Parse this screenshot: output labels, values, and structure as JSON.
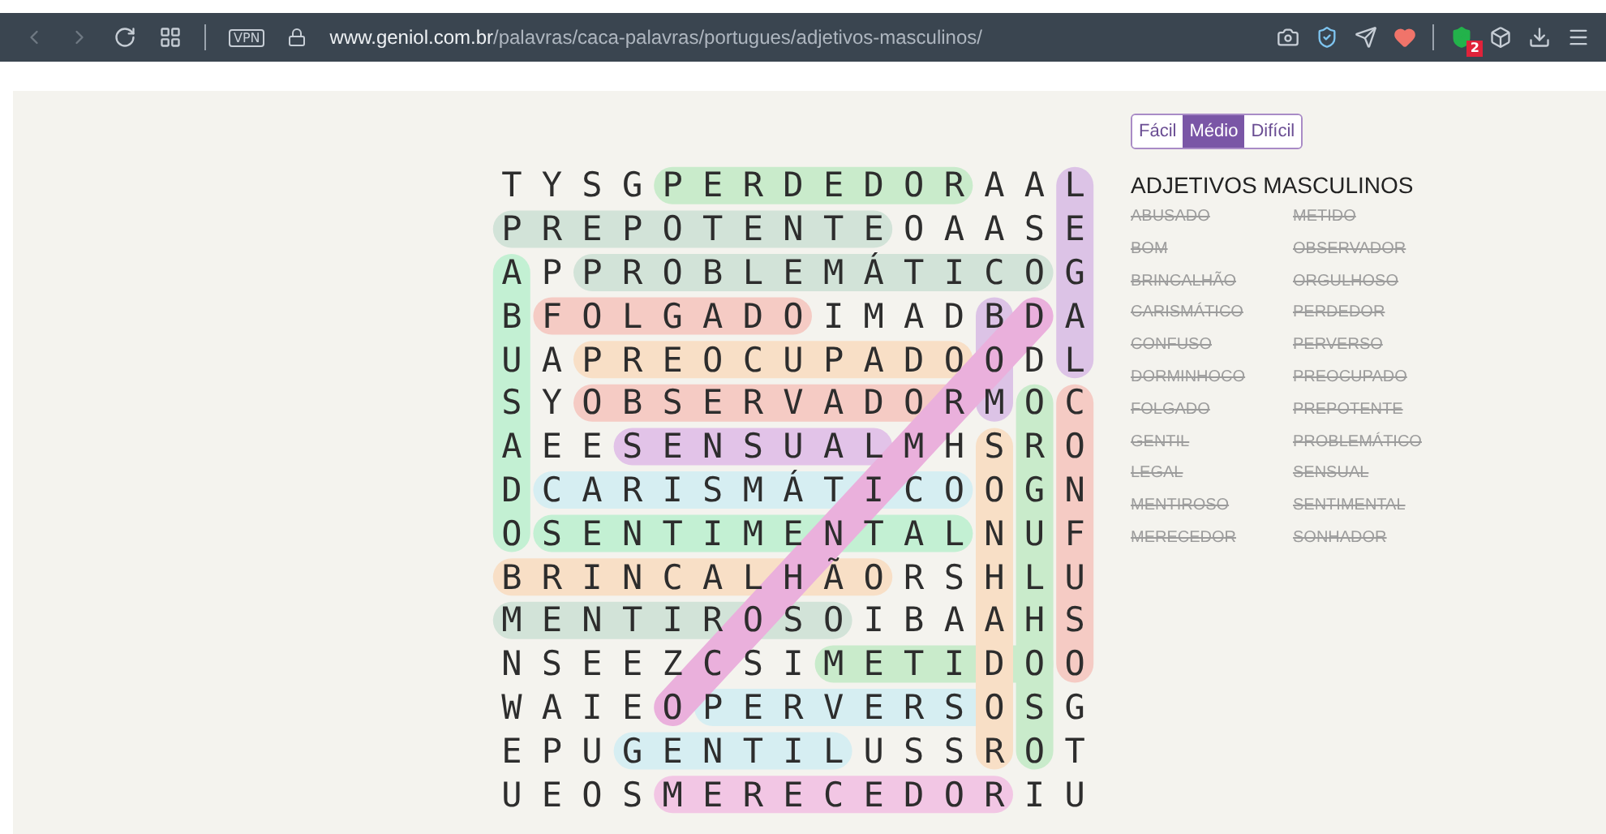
{
  "browser": {
    "vpn_badge": "VPN",
    "url_host": "www.geniol.com.br",
    "url_path": "/palavras/caca-palavras/portugues/adjetivos-masculinos/",
    "extension_badge": "2"
  },
  "difficulty": [
    {
      "label": "Fácil",
      "selected": false
    },
    {
      "label": "Médio",
      "selected": true
    },
    {
      "label": "Difícil",
      "selected": false
    }
  ],
  "grid": {
    "rows": [
      [
        "T",
        "Y",
        "S",
        "G",
        "P",
        "E",
        "R",
        "D",
        "E",
        "D",
        "O",
        "R",
        "A",
        "A",
        "L"
      ],
      [
        "P",
        "R",
        "E",
        "P",
        "O",
        "T",
        "E",
        "N",
        "T",
        "E",
        "O",
        "A",
        "A",
        "S",
        "E"
      ],
      [
        "A",
        "P",
        "P",
        "R",
        "O",
        "B",
        "L",
        "E",
        "M",
        "Á",
        "T",
        "I",
        "C",
        "O",
        "G"
      ],
      [
        "B",
        "F",
        "O",
        "L",
        "G",
        "A",
        "D",
        "O",
        "I",
        "M",
        "A",
        "D",
        "B",
        "D",
        "A"
      ],
      [
        "U",
        "A",
        "P",
        "R",
        "E",
        "O",
        "C",
        "U",
        "P",
        "A",
        "D",
        "O",
        "O",
        "D",
        "L"
      ],
      [
        "S",
        "Y",
        "O",
        "B",
        "S",
        "E",
        "R",
        "V",
        "A",
        "D",
        "O",
        "R",
        "M",
        "O",
        "C"
      ],
      [
        "A",
        "E",
        "E",
        "S",
        "E",
        "N",
        "S",
        "U",
        "A",
        "L",
        "M",
        "H",
        "S",
        "R",
        "O"
      ],
      [
        "D",
        "C",
        "A",
        "R",
        "I",
        "S",
        "M",
        "Á",
        "T",
        "I",
        "C",
        "O",
        "O",
        "G",
        "N"
      ],
      [
        "O",
        "S",
        "E",
        "N",
        "T",
        "I",
        "M",
        "E",
        "N",
        "T",
        "A",
        "L",
        "N",
        "U",
        "F"
      ],
      [
        "B",
        "R",
        "I",
        "N",
        "C",
        "A",
        "L",
        "H",
        "Ã",
        "O",
        "R",
        "S",
        "H",
        "L",
        "U"
      ],
      [
        "M",
        "E",
        "N",
        "T",
        "I",
        "R",
        "O",
        "S",
        "O",
        "I",
        "B",
        "A",
        "A",
        "H",
        "S"
      ],
      [
        "N",
        "S",
        "E",
        "E",
        "Z",
        "C",
        "S",
        "I",
        "M",
        "E",
        "T",
        "I",
        "D",
        "O",
        "O"
      ],
      [
        "W",
        "A",
        "I",
        "E",
        "O",
        "P",
        "E",
        "R",
        "V",
        "E",
        "R",
        "S",
        "O",
        "S",
        "G"
      ],
      [
        "E",
        "P",
        "U",
        "G",
        "E",
        "N",
        "T",
        "I",
        "L",
        "U",
        "S",
        "S",
        "R",
        "O",
        "T"
      ],
      [
        "U",
        "E",
        "O",
        "S",
        "M",
        "E",
        "R",
        "E",
        "C",
        "E",
        "D",
        "O",
        "R",
        "I",
        "U"
      ]
    ]
  },
  "word_list": {
    "title": "ADJETIVOS MASCULINOS",
    "words": [
      {
        "text": "ABUSADO",
        "found": true,
        "color": "#c3f0d3"
      },
      {
        "text": "BOM",
        "found": true,
        "color": "#dcc3e6"
      },
      {
        "text": "BRINCALHÃO",
        "found": true,
        "color": "#f8dfc6"
      },
      {
        "text": "CARISMÁTICO",
        "found": true,
        "color": "#d6eef2"
      },
      {
        "text": "CONFUSO",
        "found": true,
        "color": "#f5cbc4"
      },
      {
        "text": "DORMINHOCO",
        "found": true,
        "color": "#eab0dc"
      },
      {
        "text": "FOLGADO",
        "found": true,
        "color": "#f5cbc4"
      },
      {
        "text": "GENTIL",
        "found": true,
        "color": "#d6eef2"
      },
      {
        "text": "LEGAL",
        "found": true,
        "color": "#dcc3e6"
      },
      {
        "text": "MENTIROSO",
        "found": true,
        "color": "#d2e3d8"
      },
      {
        "text": "MERECEDOR",
        "found": true,
        "color": "#f2c6e4"
      },
      {
        "text": "METIDO",
        "found": true,
        "color": "#c9ebcb"
      },
      {
        "text": "OBSERVADOR",
        "found": true,
        "color": "#f5cbc4"
      },
      {
        "text": "ORGULHOSO",
        "found": true,
        "color": "#c9ebcb"
      },
      {
        "text": "PERDEDOR",
        "found": true,
        "color": "#c9ebcb"
      },
      {
        "text": "PERVERSO",
        "found": true,
        "color": "#d6eef2"
      },
      {
        "text": "PREOCUPADO",
        "found": true,
        "color": "#f8dfc6"
      },
      {
        "text": "PREPOTENTE",
        "found": true,
        "color": "#d2e3d8"
      },
      {
        "text": "PROBLEMÁTICO",
        "found": true,
        "color": "#d2e3d8"
      },
      {
        "text": "SENSUAL",
        "found": true,
        "color": "#e2c3e8"
      },
      {
        "text": "SENTIMENTAL",
        "found": true,
        "color": "#c3f0d3"
      },
      {
        "text": "SONHADOR",
        "found": true,
        "color": "#f8dfc6"
      }
    ]
  }
}
